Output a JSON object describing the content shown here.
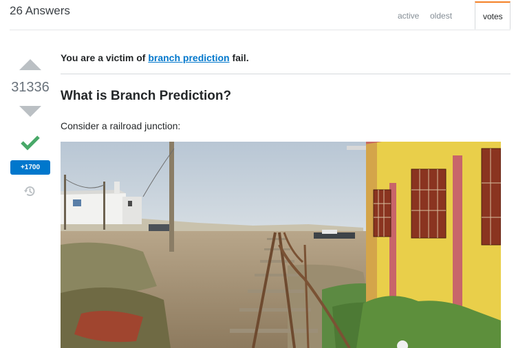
{
  "answers_header": {
    "count_label": "26 Answers",
    "tabs": [
      {
        "label": "active",
        "selected": false
      },
      {
        "label": "oldest",
        "selected": false
      },
      {
        "label": "votes",
        "selected": true
      }
    ]
  },
  "votes": {
    "score": "31336",
    "bounty": "+1700",
    "accepted": true,
    "icons": [
      "vote-up-icon",
      "vote-down-icon",
      "accepted-check-icon",
      "history-icon"
    ]
  },
  "post": {
    "intro_before": "You are a victim of ",
    "intro_link": "branch prediction",
    "intro_after": " fail.",
    "heading": "What is Branch Prediction?",
    "paragraph": "Consider a railroad junction:"
  },
  "colors": {
    "link": "#0077cc",
    "accent_orange": "#f48024",
    "accepted_green": "#48a868",
    "bounty_blue": "#0077cc"
  }
}
